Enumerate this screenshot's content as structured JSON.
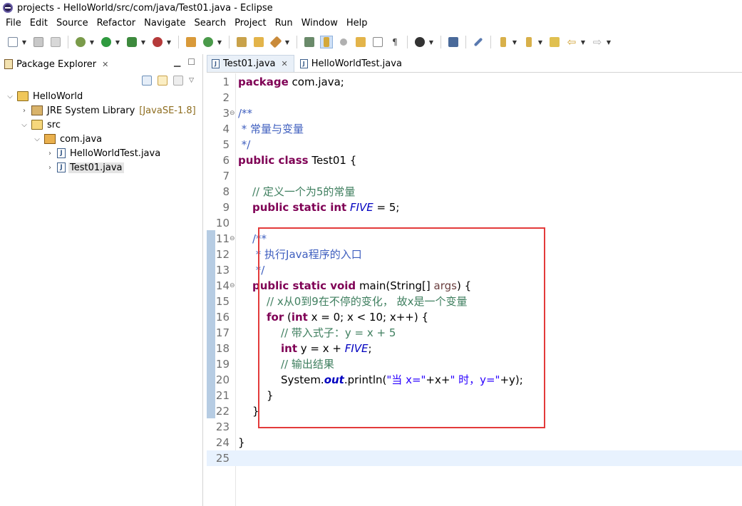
{
  "window": {
    "title": "projects - HelloWorld/src/com/java/Test01.java - Eclipse"
  },
  "menu": [
    "File",
    "Edit",
    "Source",
    "Refactor",
    "Navigate",
    "Search",
    "Project",
    "Run",
    "Window",
    "Help"
  ],
  "package_explorer": {
    "title": "Package Explorer",
    "tree": {
      "project": "HelloWorld",
      "library": "JRE System Library",
      "library_decoration": "[JavaSE-1.8]",
      "src": "src",
      "package": "com.java",
      "file1": "HelloWorldTest.java",
      "file2": "Test01.java"
    }
  },
  "editor": {
    "tabs": [
      "Test01.java",
      "HelloWorldTest.java"
    ],
    "line_numbers": [
      "1",
      "2",
      "3",
      "4",
      "5",
      "6",
      "7",
      "8",
      "9",
      "10",
      "11",
      "12",
      "13",
      "14",
      "15",
      "16",
      "17",
      "18",
      "19",
      "20",
      "21",
      "22",
      "23",
      "24",
      "25"
    ],
    "code": {
      "l1_kw": "package",
      "l1_rest": " com.java;",
      "l3": "/**",
      "l4": " * 常量与变量",
      "l5": " */",
      "l6_kw": "public class",
      "l6_rest": " Test01 {",
      "l8": "// 定义一个为5的常量",
      "l9_kw": "public static int",
      "l9_field": "FIVE",
      "l9_rest": " = 5;",
      "l11": "/**",
      "l12": " * 执行Java程序的入口",
      "l13": " */",
      "l14_kw": "public static void",
      "l14_a": " main(String[] ",
      "l14_param": "args",
      "l14_b": ") {",
      "l15": "// x从0到9在不停的变化， 故x是一个变量",
      "l16_kw": "for",
      "l16_a": " (",
      "l16_kw2": "int",
      "l16_b": " x = 0; x < 10; x++) {",
      "l17": "// 带入式子：y = x + 5",
      "l18_kw": "int",
      "l18_a": " y = x + ",
      "l18_field": "FIVE",
      "l18_b": ";",
      "l19": "// 输出结果",
      "l20_a": "System.",
      "l20_out": "out",
      "l20_b": ".println(",
      "l20_s1": "\"当 x=\"",
      "l20_c": "+x+",
      "l20_s2": "\" 时，y=\"",
      "l20_d": "+y);",
      "l21": "}",
      "l22": "}",
      "l24": "}"
    }
  }
}
